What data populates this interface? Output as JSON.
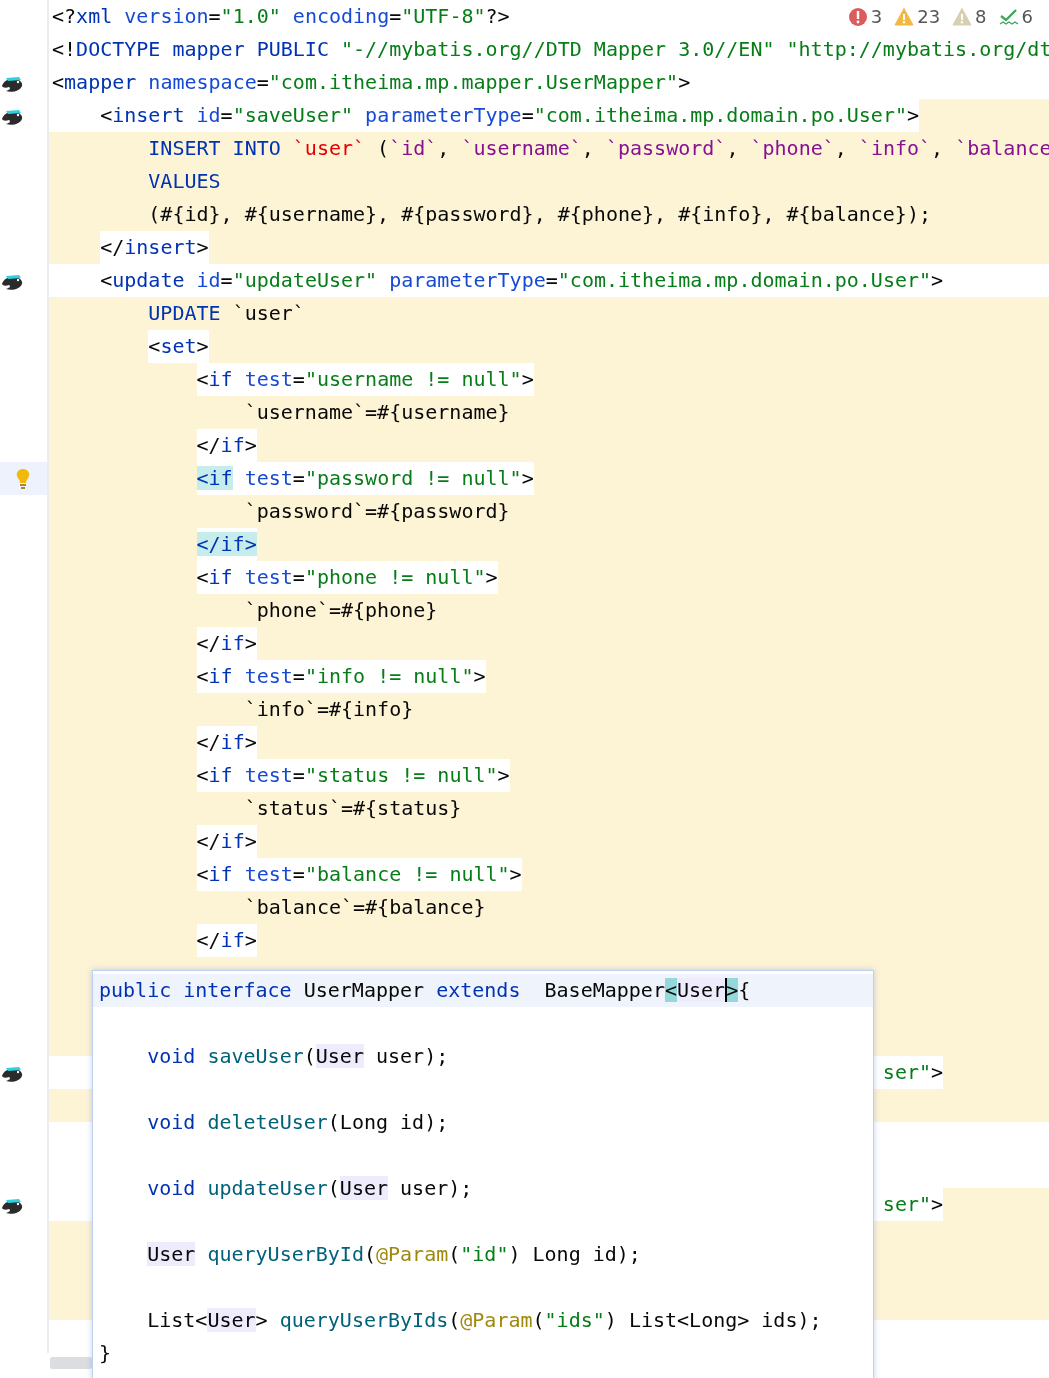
{
  "inspections": [
    {
      "kind": "error",
      "count": "3"
    },
    {
      "kind": "warning",
      "count": "23"
    },
    {
      "kind": "weak_warning",
      "count": "8"
    },
    {
      "kind": "typo",
      "count": "6"
    }
  ],
  "editor": {
    "lines": [
      {
        "highlight": false,
        "highlight_tail": false,
        "current": false,
        "tokens": [
          {
            "text": "<?",
            "kind": "p"
          },
          {
            "text": "xml ",
            "kind": "tag"
          },
          {
            "text": "version",
            "kind": "attr"
          },
          {
            "text": "=",
            "kind": "p"
          },
          {
            "text": "\"1.0\" ",
            "kind": "str"
          },
          {
            "text": "encoding",
            "kind": "attr"
          },
          {
            "text": "=",
            "kind": "p"
          },
          {
            "text": "\"UTF-8\"",
            "kind": "str"
          },
          {
            "text": "?>",
            "kind": "p"
          }
        ]
      },
      {
        "highlight": false,
        "highlight_tail": false,
        "current": false,
        "tokens": [
          {
            "text": "<!",
            "kind": "p"
          },
          {
            "text": "DOCTYPE mapper PUBLIC ",
            "kind": "tag"
          },
          {
            "text": "\"-//mybatis.org//DTD Mapper 3.0//EN\" \"http://mybatis.org/dt",
            "kind": "str"
          }
        ]
      },
      {
        "highlight": false,
        "highlight_tail": false,
        "current": false,
        "marker": {
          "kind": "navigate"
        },
        "tokens": [
          {
            "text": "<",
            "kind": "p"
          },
          {
            "text": "mapper ",
            "kind": "tag"
          },
          {
            "text": "namespace",
            "kind": "attr"
          },
          {
            "text": "=",
            "kind": "p"
          },
          {
            "text": "\"com.itheima.mp.mapper.UserMapper\"",
            "kind": "str"
          },
          {
            "text": ">",
            "kind": "p"
          }
        ]
      },
      {
        "highlight": false,
        "highlight_tail": true,
        "current": false,
        "marker": {
          "kind": "navigate"
        },
        "tokens": [
          {
            "text": "    <",
            "kind": "p"
          },
          {
            "text": "insert ",
            "kind": "tag"
          },
          {
            "text": "id",
            "kind": "attr"
          },
          {
            "text": "=",
            "kind": "p"
          },
          {
            "text": "\"saveUser\" ",
            "kind": "str"
          },
          {
            "text": "parameterType",
            "kind": "attr"
          },
          {
            "text": "=",
            "kind": "p"
          },
          {
            "text": "\"com.itheima.mp.domain.po.User\"",
            "kind": "str"
          },
          {
            "text": ">",
            "kind": "p"
          }
        ]
      },
      {
        "highlight": true,
        "highlight_tail": false,
        "boxed": false,
        "current": false,
        "tokens": [
          {
            "text": "        INSERT INTO ",
            "kind": "kw"
          },
          {
            "text": "`user`",
            "kind": "red"
          },
          {
            "text": " (",
            "kind": "p"
          },
          {
            "text": "`id`",
            "kind": "col"
          },
          {
            "text": ", ",
            "kind": "p"
          },
          {
            "text": "`username`",
            "kind": "col"
          },
          {
            "text": ", ",
            "kind": "p"
          },
          {
            "text": "`password`",
            "kind": "col"
          },
          {
            "text": ", ",
            "kind": "p"
          },
          {
            "text": "`phone`",
            "kind": "col"
          },
          {
            "text": ", ",
            "kind": "p"
          },
          {
            "text": "`info`",
            "kind": "col"
          },
          {
            "text": ", ",
            "kind": "p"
          },
          {
            "text": "`balance",
            "kind": "col"
          }
        ]
      },
      {
        "highlight": true,
        "highlight_tail": false,
        "boxed": false,
        "current": false,
        "tokens": [
          {
            "text": "        VALUES",
            "kind": "kw"
          }
        ]
      },
      {
        "highlight": true,
        "highlight_tail": false,
        "boxed": false,
        "current": false,
        "tokens": [
          {
            "text": "        (#{id}, #{username}, #{password}, #{phone}, #{info}, #{balance});",
            "kind": "p"
          }
        ]
      },
      {
        "highlight": true,
        "highlight_tail": false,
        "boxed": true,
        "current": false,
        "tokens": [
          {
            "text": "    </",
            "kind": "p"
          },
          {
            "text": "insert",
            "kind": "tag"
          },
          {
            "text": ">",
            "kind": "p"
          }
        ]
      },
      {
        "highlight": false,
        "highlight_tail": false,
        "current": false,
        "marker": {
          "kind": "navigate"
        },
        "tokens": [
          {
            "text": "    <",
            "kind": "p"
          },
          {
            "text": "update ",
            "kind": "tag"
          },
          {
            "text": "id",
            "kind": "attr"
          },
          {
            "text": "=",
            "kind": "p"
          },
          {
            "text": "\"updateUser\" ",
            "kind": "str"
          },
          {
            "text": "parameterType",
            "kind": "attr"
          },
          {
            "text": "=",
            "kind": "p"
          },
          {
            "text": "\"com.itheima.mp.domain.po.User\"",
            "kind": "str"
          },
          {
            "text": ">",
            "kind": "p"
          }
        ]
      },
      {
        "highlight": true,
        "highlight_tail": false,
        "boxed": false,
        "current": false,
        "tokens": [
          {
            "text": "        UPDATE ",
            "kind": "kw"
          },
          {
            "text": "`user`",
            "kind": "p"
          }
        ]
      },
      {
        "highlight": true,
        "highlight_tail": false,
        "boxed": true,
        "current": false,
        "tokens": [
          {
            "text": "        <",
            "kind": "p"
          },
          {
            "text": "set",
            "kind": "tag"
          },
          {
            "text": ">",
            "kind": "p"
          }
        ]
      },
      {
        "highlight": true,
        "highlight_tail": false,
        "boxed": true,
        "current": false,
        "tokens": [
          {
            "text": "            <",
            "kind": "p"
          },
          {
            "text": "if ",
            "kind": "tag"
          },
          {
            "text": "test",
            "kind": "attr"
          },
          {
            "text": "=",
            "kind": "p"
          },
          {
            "text": "\"username != null\"",
            "kind": "str"
          },
          {
            "text": ">",
            "kind": "p"
          }
        ]
      },
      {
        "highlight": true,
        "highlight_tail": false,
        "boxed": false,
        "current": false,
        "tokens": [
          {
            "text": "                `username`=#{username}",
            "kind": "p"
          }
        ]
      },
      {
        "highlight": true,
        "highlight_tail": false,
        "boxed": true,
        "current": false,
        "tokens": [
          {
            "text": "            </",
            "kind": "p"
          },
          {
            "text": "if",
            "kind": "tag"
          },
          {
            "text": ">",
            "kind": "p"
          }
        ]
      },
      {
        "highlight": true,
        "highlight_tail": false,
        "boxed": true,
        "current": true,
        "marker": {
          "kind": "intention"
        },
        "tokens": [
          {
            "text": "            <if",
            "kind": "tag_match"
          },
          {
            "text": " test",
            "kind": "attr"
          },
          {
            "text": "=",
            "kind": "p"
          },
          {
            "text": "\"password != null\"",
            "kind": "str"
          },
          {
            "text": ">",
            "kind": "p"
          }
        ]
      },
      {
        "highlight": true,
        "highlight_tail": false,
        "boxed": false,
        "current": false,
        "tokens": [
          {
            "text": "                `password`=#{password}",
            "kind": "p"
          }
        ]
      },
      {
        "highlight": true,
        "highlight_tail": false,
        "boxed": true,
        "current": false,
        "tokens": [
          {
            "text": "            </if>",
            "kind": "tag_match"
          }
        ]
      },
      {
        "highlight": true,
        "highlight_tail": false,
        "boxed": true,
        "current": false,
        "tokens": [
          {
            "text": "            <",
            "kind": "p"
          },
          {
            "text": "if ",
            "kind": "tag"
          },
          {
            "text": "test",
            "kind": "attr"
          },
          {
            "text": "=",
            "kind": "p"
          },
          {
            "text": "\"phone != null\"",
            "kind": "str"
          },
          {
            "text": ">",
            "kind": "p"
          }
        ]
      },
      {
        "highlight": true,
        "highlight_tail": false,
        "boxed": false,
        "current": false,
        "tokens": [
          {
            "text": "                `phone`=#{phone}",
            "kind": "p"
          }
        ]
      },
      {
        "highlight": true,
        "highlight_tail": false,
        "boxed": true,
        "current": false,
        "tokens": [
          {
            "text": "            </",
            "kind": "p"
          },
          {
            "text": "if",
            "kind": "tag"
          },
          {
            "text": ">",
            "kind": "p"
          }
        ]
      },
      {
        "highlight": true,
        "highlight_tail": false,
        "boxed": true,
        "current": false,
        "tokens": [
          {
            "text": "            <",
            "kind": "p"
          },
          {
            "text": "if ",
            "kind": "tag"
          },
          {
            "text": "test",
            "kind": "attr"
          },
          {
            "text": "=",
            "kind": "p"
          },
          {
            "text": "\"info != null\"",
            "kind": "str"
          },
          {
            "text": ">",
            "kind": "p"
          }
        ]
      },
      {
        "highlight": true,
        "highlight_tail": false,
        "boxed": false,
        "current": false,
        "tokens": [
          {
            "text": "                `info`=#{info}",
            "kind": "p"
          }
        ]
      },
      {
        "highlight": true,
        "highlight_tail": false,
        "boxed": true,
        "current": false,
        "tokens": [
          {
            "text": "            </",
            "kind": "p"
          },
          {
            "text": "if",
            "kind": "tag"
          },
          {
            "text": ">",
            "kind": "p"
          }
        ]
      },
      {
        "highlight": true,
        "highlight_tail": false,
        "boxed": true,
        "current": false,
        "tokens": [
          {
            "text": "            <",
            "kind": "p"
          },
          {
            "text": "if ",
            "kind": "tag"
          },
          {
            "text": "test",
            "kind": "attr"
          },
          {
            "text": "=",
            "kind": "p"
          },
          {
            "text": "\"status != null\"",
            "kind": "str"
          },
          {
            "text": ">",
            "kind": "p"
          }
        ]
      },
      {
        "highlight": true,
        "highlight_tail": false,
        "boxed": false,
        "current": false,
        "tokens": [
          {
            "text": "                `status`=#{status}",
            "kind": "p"
          }
        ]
      },
      {
        "highlight": true,
        "highlight_tail": false,
        "boxed": true,
        "current": false,
        "tokens": [
          {
            "text": "            </",
            "kind": "p"
          },
          {
            "text": "if",
            "kind": "tag"
          },
          {
            "text": ">",
            "kind": "p"
          }
        ]
      },
      {
        "highlight": true,
        "highlight_tail": false,
        "boxed": true,
        "current": false,
        "tokens": [
          {
            "text": "            <",
            "kind": "p"
          },
          {
            "text": "if ",
            "kind": "tag"
          },
          {
            "text": "test",
            "kind": "attr"
          },
          {
            "text": "=",
            "kind": "p"
          },
          {
            "text": "\"balance != null\"",
            "kind": "str"
          },
          {
            "text": ">",
            "kind": "p"
          }
        ]
      },
      {
        "highlight": true,
        "highlight_tail": false,
        "boxed": false,
        "current": false,
        "tokens": [
          {
            "text": "                `balance`=#{balance}",
            "kind": "p"
          }
        ]
      },
      {
        "highlight": true,
        "highlight_tail": false,
        "boxed": true,
        "current": false,
        "tokens": [
          {
            "text": "            </",
            "kind": "p"
          },
          {
            "text": "if",
            "kind": "tag"
          },
          {
            "text": ">",
            "kind": "p"
          }
        ]
      },
      {
        "highlight": true,
        "highlight_tail": false,
        "current": false
      },
      {
        "highlight": true,
        "highlight_tail": false,
        "current": false
      },
      {
        "highlight": true,
        "highlight_tail": false,
        "current": false
      },
      {
        "highlight": false,
        "highlight_tail": true,
        "current": false,
        "marker": {
          "kind": "navigate"
        },
        "tokens": [
          {
            "text": "                                                                     ser\"",
            "kind": "str"
          },
          {
            "text": ">",
            "kind": "p"
          }
        ]
      },
      {
        "highlight": true,
        "highlight_tail": false,
        "current": false
      },
      {
        "highlight": false,
        "highlight_tail": false,
        "current": false
      },
      {
        "highlight": false,
        "highlight_tail": false,
        "current": false
      },
      {
        "highlight": false,
        "highlight_tail": true,
        "current": false,
        "marker": {
          "kind": "navigate"
        },
        "tokens": [
          {
            "text": "                                                                     ser\"",
            "kind": "str"
          },
          {
            "text": ">",
            "kind": "p"
          }
        ]
      },
      {
        "highlight": true,
        "highlight_tail": false,
        "current": false
      },
      {
        "highlight": true,
        "highlight_tail": false,
        "current": false
      },
      {
        "highlight": true,
        "highlight_tail": false,
        "current": false
      },
      {
        "highlight": false,
        "highlight_tail": false,
        "current": false
      }
    ]
  },
  "popup": {
    "lines": [
      {
        "blank_before": false,
        "current": true,
        "tokens": [
          {
            "text": "public interface ",
            "kind": "kw"
          },
          {
            "text": "UserMapper ",
            "kind": "p"
          },
          {
            "text": "extends  ",
            "kind": "kw"
          },
          {
            "text": "BaseMapper",
            "kind": "p"
          },
          {
            "text": "<",
            "kind": "brace"
          },
          {
            "text": "User",
            "kind": "ref"
          },
          {
            "text": ">",
            "kind": "brace_caret"
          },
          {
            "text": "{",
            "kind": "p"
          }
        ]
      },
      {
        "blank_before": true,
        "current": false,
        "tokens": [
          {
            "text": "    void ",
            "kind": "kw"
          },
          {
            "text": "saveUser",
            "kind": "meth"
          },
          {
            "text": "(",
            "kind": "p"
          },
          {
            "text": "User",
            "kind": "ref"
          },
          {
            "text": " user);",
            "kind": "p"
          }
        ]
      },
      {
        "blank_before": true,
        "current": false,
        "tokens": [
          {
            "text": "    void ",
            "kind": "kw"
          },
          {
            "text": "deleteUser",
            "kind": "meth"
          },
          {
            "text": "(Long id);",
            "kind": "p"
          }
        ]
      },
      {
        "blank_before": true,
        "current": false,
        "tokens": [
          {
            "text": "    void ",
            "kind": "kw"
          },
          {
            "text": "updateUser",
            "kind": "meth"
          },
          {
            "text": "(",
            "kind": "p"
          },
          {
            "text": "User",
            "kind": "ref"
          },
          {
            "text": " user);",
            "kind": "p"
          }
        ]
      },
      {
        "blank_before": true,
        "current": false,
        "tokens": [
          {
            "text": "    User",
            "kind": "ref"
          },
          {
            "text": " queryUserById",
            "kind": "meth"
          },
          {
            "text": "(",
            "kind": "p"
          },
          {
            "text": "@Param",
            "kind": "ann"
          },
          {
            "text": "(",
            "kind": "p"
          },
          {
            "text": "\"id\"",
            "kind": "str"
          },
          {
            "text": ") Long id);",
            "kind": "p"
          }
        ]
      },
      {
        "blank_before": true,
        "current": false,
        "tokens": [
          {
            "text": "    List<",
            "kind": "p"
          },
          {
            "text": "User",
            "kind": "ref"
          },
          {
            "text": "> ",
            "kind": "p"
          },
          {
            "text": "queryUserByIds",
            "kind": "meth"
          },
          {
            "text": "(",
            "kind": "p"
          },
          {
            "text": "@Param",
            "kind": "ann"
          },
          {
            "text": "(",
            "kind": "p"
          },
          {
            "text": "\"ids\"",
            "kind": "str"
          },
          {
            "text": ") List<Long> ids);",
            "kind": "p"
          }
        ]
      },
      {
        "blank_before": false,
        "current": false,
        "tokens": [
          {
            "text": "}",
            "kind": "p"
          }
        ]
      }
    ]
  }
}
